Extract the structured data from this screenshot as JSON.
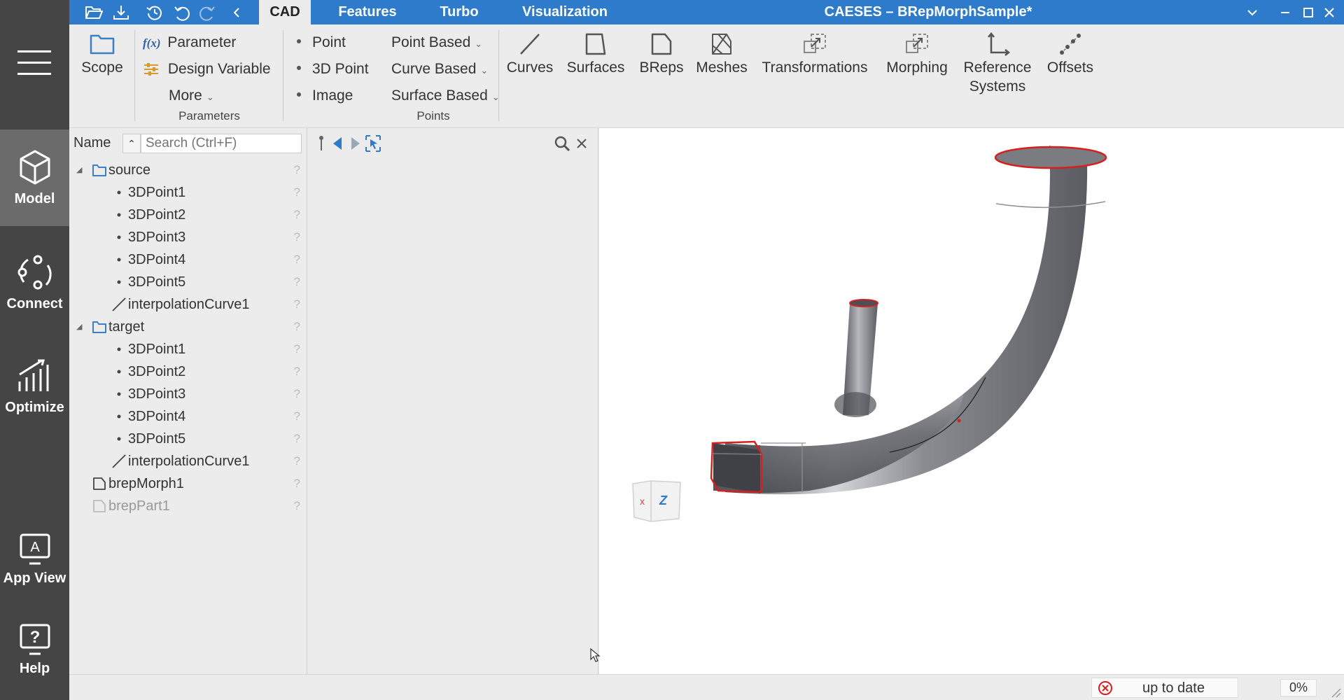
{
  "window": {
    "title": "CAESES – BRepMorphSample*"
  },
  "tabs": [
    {
      "label": "CAD",
      "active": true
    },
    {
      "label": "Features"
    },
    {
      "label": "Turbo"
    },
    {
      "label": "Visualization"
    }
  ],
  "sidebar": {
    "items": [
      {
        "label": "Model",
        "icon": "cube-icon",
        "active": true
      },
      {
        "label": "Connect",
        "icon": "connect-icon"
      },
      {
        "label": "Optimize",
        "icon": "chart-icon"
      },
      {
        "label": "App View",
        "icon": "app-view-icon"
      },
      {
        "label": "Help",
        "icon": "help-icon"
      }
    ]
  },
  "ribbon": {
    "scope": "Scope",
    "parameter": "Parameter",
    "design_variable": "Design Variable",
    "more": "More",
    "group_parameters": "Parameters",
    "point": "Point",
    "point3d": "3D Point",
    "image": "Image",
    "point_based": "Point Based",
    "curve_based": "Curve Based",
    "surface_based": "Surface Based",
    "group_points": "Points",
    "curves": "Curves",
    "surfaces": "Surfaces",
    "breps": "BReps",
    "meshes": "Meshes",
    "transformations": "Transformations",
    "morphing": "Morphing",
    "reference_systems_1": "Reference",
    "reference_systems_2": "Systems",
    "offsets": "Offsets",
    "fx": "f(x)"
  },
  "tree": {
    "header": "Name",
    "search_placeholder": "Search (Ctrl+F)",
    "help_mark": "?",
    "rows": [
      {
        "label": "source",
        "kind": "folder",
        "level": 0
      },
      {
        "label": "3DPoint1",
        "kind": "point",
        "level": 1
      },
      {
        "label": "3DPoint2",
        "kind": "point",
        "level": 1
      },
      {
        "label": "3DPoint3",
        "kind": "point",
        "level": 1
      },
      {
        "label": "3DPoint4",
        "kind": "point",
        "level": 1
      },
      {
        "label": "3DPoint5",
        "kind": "point",
        "level": 1
      },
      {
        "label": "interpolationCurve1",
        "kind": "curve",
        "level": 1
      },
      {
        "label": "target",
        "kind": "folder",
        "level": 0
      },
      {
        "label": "3DPoint1",
        "kind": "point",
        "level": 1
      },
      {
        "label": "3DPoint2",
        "kind": "point",
        "level": 1
      },
      {
        "label": "3DPoint3",
        "kind": "point",
        "level": 1
      },
      {
        "label": "3DPoint4",
        "kind": "point",
        "level": 1
      },
      {
        "label": "3DPoint5",
        "kind": "point",
        "level": 1
      },
      {
        "label": "interpolationCurve1",
        "kind": "curve",
        "level": 1
      },
      {
        "label": "brepMorph1",
        "kind": "brep",
        "level": 0
      },
      {
        "label": "brepPart1",
        "kind": "brep",
        "level": 0,
        "dim": true
      }
    ]
  },
  "viewport": {
    "axis_label": "Z"
  },
  "status": {
    "text": "up to date",
    "progress": "0%"
  },
  "colors": {
    "titlebar": "#2e7bcb",
    "sidebar": "#454545",
    "accent_edge": "#d62020"
  }
}
